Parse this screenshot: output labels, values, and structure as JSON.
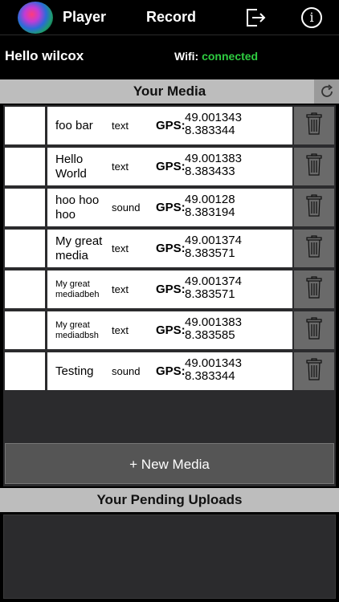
{
  "nav": {
    "player_label": "Player",
    "record_label": "Record",
    "info_glyph": "i"
  },
  "user": {
    "greeting": "Hello wilcox",
    "wifi_label": "Wifi:",
    "wifi_status": "connected",
    "wifi_status_color": "#2ecc40"
  },
  "media": {
    "header": "Your Media",
    "gps_label": "GPS:",
    "items": [
      {
        "title": "foo bar",
        "type": "text",
        "lat": "49.001343",
        "lon": "8.383344"
      },
      {
        "title": "Hello World",
        "type": "text",
        "lat": "49.001383",
        "lon": "8.383433"
      },
      {
        "title": "hoo hoo hoo",
        "type": "sound",
        "lat": "49.00128",
        "lon": "8.383194"
      },
      {
        "title": "My great media",
        "type": "text",
        "lat": "49.001374",
        "lon": "8.383571"
      },
      {
        "title": "My great mediadbeh",
        "type": "text",
        "lat": "49.001374",
        "lon": "8.383571"
      },
      {
        "title": "My great mediadbsh",
        "type": "text",
        "lat": "49.001383",
        "lon": "8.383585"
      },
      {
        "title": "Testing",
        "type": "sound",
        "lat": "49.001343",
        "lon": "8.383344"
      }
    ],
    "new_media_label": "+ New Media"
  },
  "pending": {
    "header": "Your Pending Uploads"
  },
  "icons": {
    "logo": "app-logo",
    "logout": "logout-icon",
    "info": "info-icon",
    "refresh": "refresh-icon",
    "delete": "trash-icon"
  }
}
